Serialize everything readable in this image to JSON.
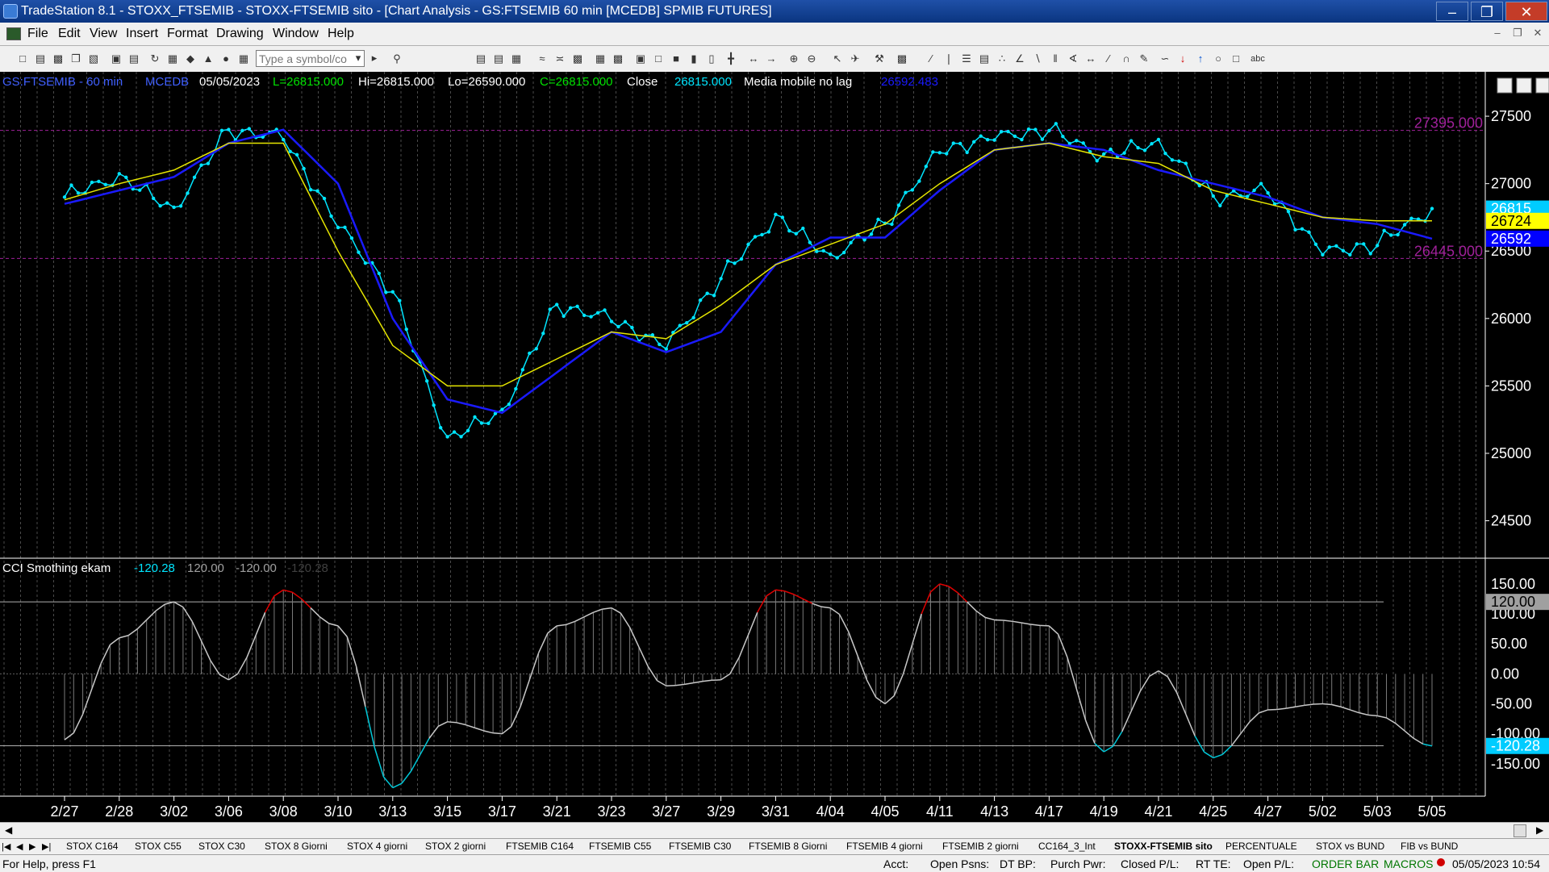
{
  "window": {
    "title": "TradeStation 8.1 - STOXX_FTSEMIB - STOXX-FTSEMIB sito - [Chart Analysis - GS:FTSEMIB  60 min  [MCEDB] SPMIB FUTURES]"
  },
  "menu": [
    "File",
    "Edit",
    "View",
    "Insert",
    "Format",
    "Drawing",
    "Window",
    "Help"
  ],
  "toolbar": {
    "symbol_placeholder": "Type a symbol/co"
  },
  "price_panel": {
    "header": {
      "symbol": "GS:FTSEMIB - 60 min",
      "data_source": "MCEDB",
      "date": "05/05/2023",
      "last": "L=26815.000",
      "high": "Hi=26815.000",
      "low": "Lo=26590.000",
      "close_eq": "C=26815.000",
      "close_label": "Close",
      "close_value": "26815.000",
      "indicator_name": "Media mobile no lag",
      "indicator_value": "26592.483"
    },
    "price_axis": [
      "27500",
      "27000",
      "26500",
      "26000",
      "25500",
      "25000",
      "24500"
    ],
    "hlines": [
      {
        "label": "27395.000",
        "value": 27395
      },
      {
        "label": "26445.000",
        "value": 26445
      }
    ],
    "markers": [
      {
        "label": "26815",
        "value": 26815,
        "bg": "#00ccff"
      },
      {
        "label": "26724",
        "value": 26724,
        "bg": "#ffff00"
      },
      {
        "label": "26592",
        "value": 26592,
        "bg": "#0000ff"
      }
    ]
  },
  "cci_panel": {
    "header": {
      "name": "CCI Smothing ekam",
      "v1": "-120.28",
      "v2": "120.00",
      "v3": "-120.00",
      "v4": "-120.28"
    },
    "axis": [
      "150.00",
      "100.00",
      "50.00",
      "0.00",
      "-50.00",
      "-100.00",
      "-150.00"
    ],
    "markers": [
      {
        "label": "120.00",
        "value": 120,
        "bg": "#a0a0a0"
      },
      {
        "label": "-120.28",
        "value": -120.28,
        "bg": "#00ccff"
      }
    ]
  },
  "date_axis": [
    "2/27",
    "2/28",
    "3/02",
    "3/06",
    "3/08",
    "3/10",
    "3/13",
    "3/15",
    "3/17",
    "3/21",
    "3/23",
    "3/27",
    "3/29",
    "3/31",
    "4/04",
    "4/05",
    "4/11",
    "4/13",
    "4/17",
    "4/19",
    "4/21",
    "4/25",
    "4/27",
    "5/02",
    "5/03",
    "5/05"
  ],
  "tabs": [
    "STOX C164",
    "STOX C55",
    "STOX  C30",
    "STOX  8 Giorni",
    "STOX 4 giorni",
    "STOX  2 giorni",
    "FTSEMIB C164",
    "FTSEMIB C55",
    "FTSEMIB C30",
    "FTSEMIB  8 Giorni",
    "FTSEMIB  4 giorni",
    "FTSEMIB  2 giorni",
    "CC164_3_Int",
    "STOXX-FTSEMIB sito",
    "PERCENTUALE",
    "STOX vs BUND",
    "FIB vs BUND"
  ],
  "active_tab": "STOXX-FTSEMIB sito",
  "status": {
    "help": "For Help, press F1",
    "acct": "Acct:",
    "open_psns": "Open Psns:",
    "dt_bp": "DT BP:",
    "purch_pwr": "Purch Pwr:",
    "closed_pl": "Closed P/L:",
    "rt_te": "RT TE:",
    "open_pl": "Open P/L:",
    "order_bar": "ORDER BAR",
    "macros": "MACROS",
    "datetime": "05/05/2023 10:54"
  },
  "colors": {
    "price": "#00e5ff",
    "avg_fast": "#1a1aff",
    "avg_slow": "#e6e600",
    "hline": "#a0209a",
    "cci_line": "#c8c8c8",
    "cci_over": "#e00000",
    "cci_under": "#00c8d8"
  },
  "chart_data": [
    {
      "type": "line",
      "title": "GS:FTSEMIB - 60 min",
      "x": [
        "2/27",
        "2/28",
        "3/02",
        "3/06",
        "3/08",
        "3/10",
        "3/13",
        "3/15",
        "3/17",
        "3/21",
        "3/23",
        "3/27",
        "3/29",
        "3/31",
        "4/04",
        "4/05",
        "4/11",
        "4/13",
        "4/17",
        "4/19",
        "4/21",
        "4/25",
        "4/27",
        "5/02",
        "5/03",
        "5/05"
      ],
      "ylim": [
        24300,
        27650
      ],
      "series": [
        {
          "name": "Close",
          "values": [
            26900,
            27050,
            26800,
            27400,
            27350,
            26700,
            26200,
            25100,
            25300,
            26100,
            26000,
            25800,
            26300,
            26750,
            26450,
            26700,
            27250,
            27350,
            27400,
            27200,
            27300,
            26900,
            26950,
            26500,
            26550,
            26815
          ]
        },
        {
          "name": "Media mobile no lag",
          "values": [
            26850,
            26950,
            27050,
            27300,
            27400,
            27000,
            26000,
            25400,
            25300,
            25600,
            25900,
            25750,
            25900,
            26400,
            26600,
            26600,
            26950,
            27250,
            27300,
            27250,
            27100,
            27000,
            26900,
            26750,
            26700,
            26592
          ]
        },
        {
          "values": [
            26880,
            27000,
            27100,
            27300,
            27300,
            26500,
            25800,
            25500,
            25500,
            25700,
            25900,
            25850,
            26100,
            26400,
            26550,
            26700,
            27000,
            27250,
            27300,
            27200,
            27150,
            26950,
            26850,
            26750,
            26724,
            26724
          ]
        }
      ]
    },
    {
      "type": "line",
      "title": "CCI Smothing ekam",
      "x": [
        "2/27",
        "2/28",
        "3/02",
        "3/06",
        "3/08",
        "3/10",
        "3/13",
        "3/15",
        "3/17",
        "3/21",
        "3/23",
        "3/27",
        "3/29",
        "3/31",
        "4/04",
        "4/05",
        "4/11",
        "4/13",
        "4/17",
        "4/19",
        "4/21",
        "4/25",
        "4/27",
        "5/02",
        "5/03",
        "5/05"
      ],
      "ylim": [
        -200,
        170
      ],
      "series": [
        {
          "name": "CCI Smothing ekam",
          "values": [
            -110,
            60,
            120,
            -10,
            140,
            80,
            -190,
            -80,
            -100,
            80,
            110,
            -20,
            -10,
            140,
            110,
            -50,
            150,
            90,
            80,
            -130,
            5,
            -140,
            -60,
            -50,
            -70,
            -120.28
          ]
        }
      ],
      "levels": [
        120,
        -120
      ]
    }
  ]
}
